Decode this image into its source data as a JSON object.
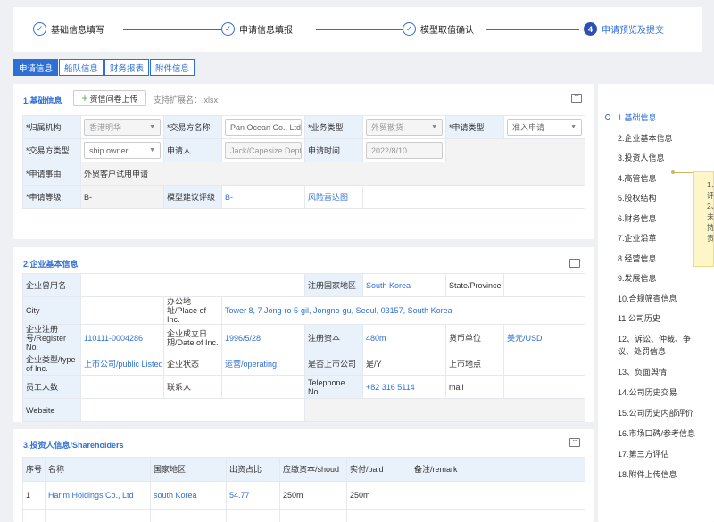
{
  "steps": [
    {
      "label": "基础信息填写",
      "icon": "check-icon"
    },
    {
      "label": "申请信息填报",
      "icon": "check-icon"
    },
    {
      "label": "模型取值确认",
      "icon": "check-icon"
    },
    {
      "label": "申请预览及提交",
      "number": "4"
    }
  ],
  "tabs": [
    "申请信息",
    "船队信息",
    "财务报表",
    "附件信息"
  ],
  "basic": {
    "title": "1.基础信息",
    "upload_label": "资信问卷上传",
    "ext_hint": "支持扩展名：.xlsx",
    "org_label": "*归属机构",
    "org_value": "香港明华",
    "counterparty_label": "*交易方名称",
    "counterparty_value": "Pan Ocean Co., Ltd",
    "biz_type_label": "*业务类型",
    "biz_type_value": "外贸散货",
    "apply_type_label": "*申请类型",
    "apply_type_value": "准入申请",
    "cp_type_label": "*交易方类型",
    "cp_type_value": "ship owner",
    "applicant_label": "申请人",
    "applicant_value": "Jack/Capesize Dept",
    "apply_time_label": "申请时间",
    "apply_time_value": "2022/8/10",
    "reason_label": "*申请事由",
    "reason_value": "外贸客户试用申请",
    "grade_label": "*申请等级",
    "grade_value": "B-",
    "model_grade_label": "模型建议评级",
    "model_grade_value": "B-",
    "radar_link": "风险雷达图"
  },
  "company": {
    "title": "2.企业基本信息",
    "alias_label": "企业曾用名",
    "alias_value": "",
    "country_label": "注册国家地区",
    "country_value": "South Korea",
    "state_label": "State/Province",
    "state_value": "",
    "city_label": "City",
    "city_value": "",
    "office_label": "办公地址/Place of Inc.",
    "office_value": "Tower 8, 7 Jong-ro 5-gil, Jongno-gu, Seoul, 03157, South Korea",
    "regno_label": "企业注册号/Register No.",
    "regno_value": "110111-0004286",
    "founded_label": "企业成立日期/Date of Inc.",
    "founded_value": "1996/5/28",
    "capital_label": "注册资本",
    "capital_value": "480m",
    "currency_label": "货币单位",
    "currency_value": "美元/USD",
    "type_label": "企业类型/type of Inc.",
    "type_value": "上市公司/public  Listed",
    "status_label": "企业状态",
    "status_value": "运营/operating",
    "listed_label": "是否上市公司",
    "listed_value": "是/Y",
    "market_label": "上市地点",
    "market_value": "",
    "staff_label": "员工人数",
    "staff_value": "",
    "contact_label": "联系人",
    "contact_value": "",
    "phone_label": "Telephone No.",
    "phone_value": "+82 316 5114",
    "mail_label": "mail",
    "mail_value": "",
    "website_label": "Website",
    "website_value": ""
  },
  "shareholders": {
    "title": "3.投资人信息/Shareholders",
    "headers": [
      "序号",
      "名称",
      "国家地区",
      "出资占比",
      "应缴资本/shoud",
      "实付/paid",
      "备注/remark"
    ],
    "rows": [
      [
        "1",
        "Harim Holdings Co., Ltd",
        "south Korea",
        "54.77",
        "250m",
        "250m",
        ""
      ]
    ]
  },
  "side_nav": [
    "1.基础信息",
    "2.企业基本信息",
    "3.投资人信息",
    "4.高管信息",
    "5.股权结构",
    "6.财务信息",
    "7.企业沿革",
    "8.经营信息",
    "9.发展信息",
    "10.合规筛查信息",
    "11.公司历史",
    "12、诉讼、仲裁、争议、处罚信息",
    "13、负面舆情",
    "14.公司历史交易",
    "15.公司历史内部评价",
    "16.市场口碑/参考信息",
    "17.第三方评估",
    "18.附件上传信息"
  ],
  "tooltip": {
    "lines": [
      "1、",
      "评",
      "2、",
      "未",
      "持",
      "责"
    ]
  },
  "colors": {
    "accent": "#2e6fd6",
    "label_bg": "#e9f1fb",
    "note_bg": "#fdf6c8"
  }
}
